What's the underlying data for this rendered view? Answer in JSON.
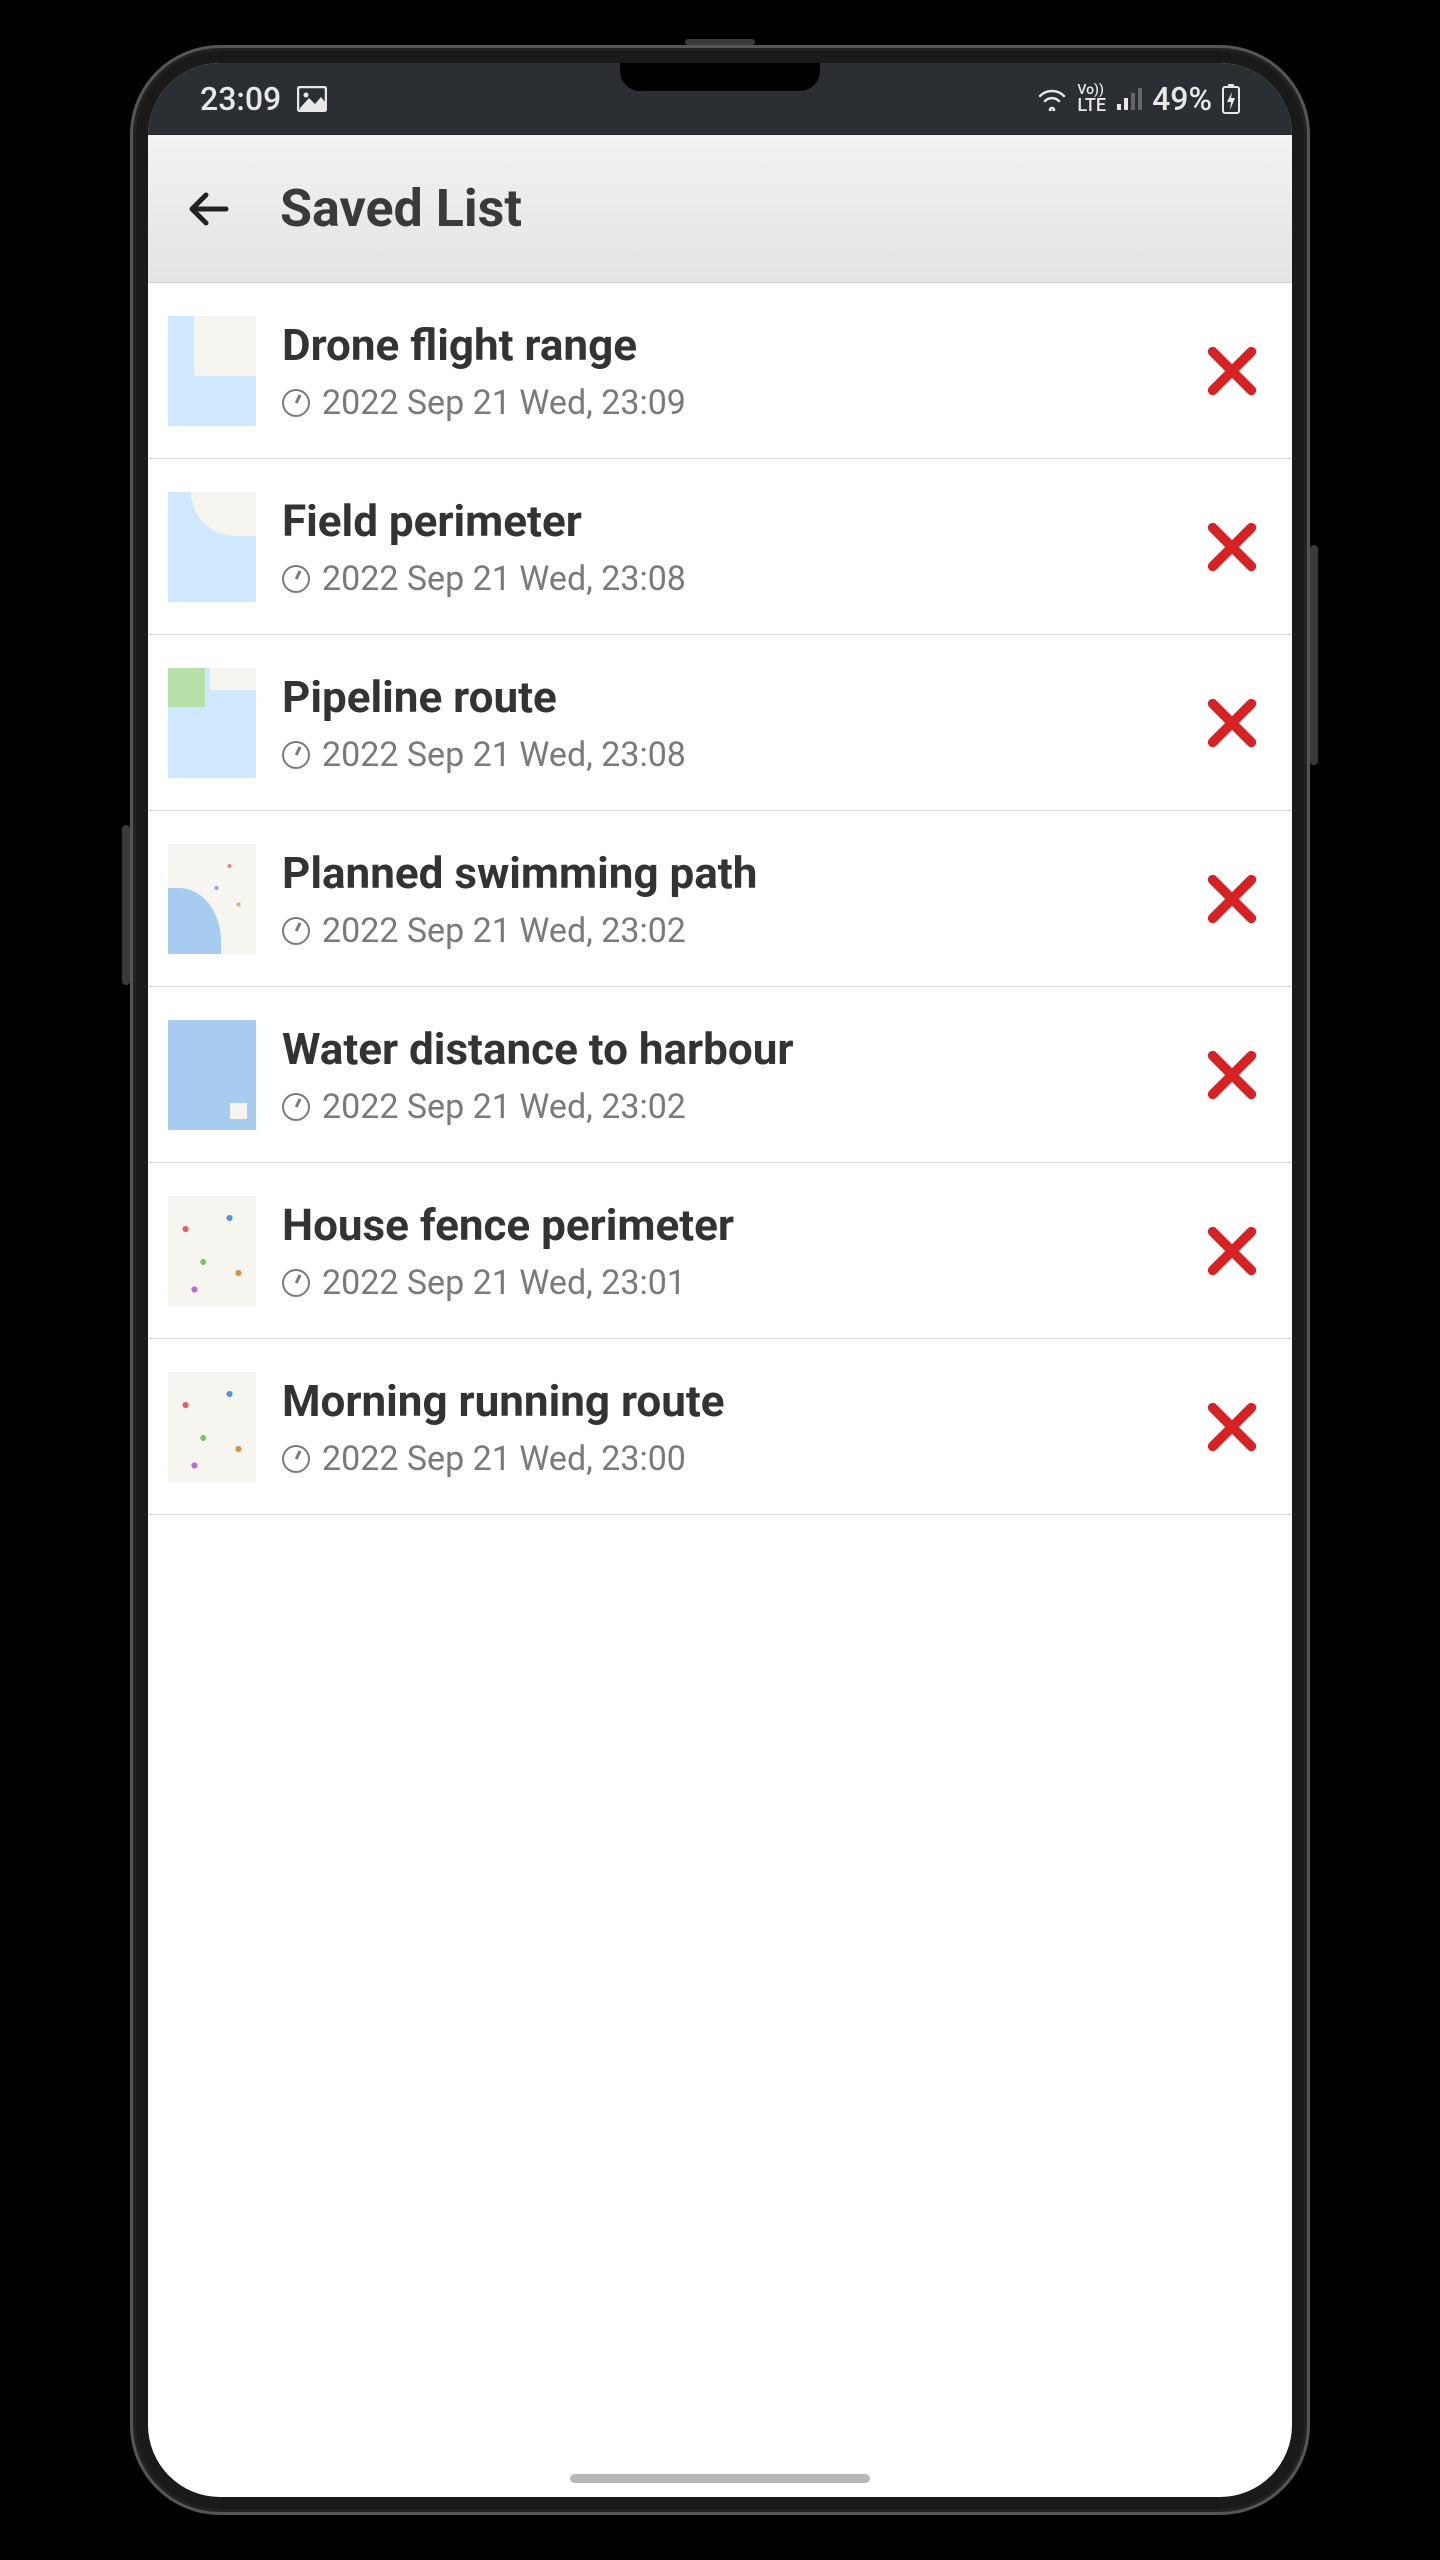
{
  "status": {
    "time": "23:09",
    "battery": "49%",
    "network_label": "LTE"
  },
  "header": {
    "title": "Saved List"
  },
  "items": [
    {
      "title": "Drone flight range",
      "timestamp": "2022 Sep 21 Wed, 23:09",
      "thumb": "land-a"
    },
    {
      "title": "Field perimeter",
      "timestamp": "2022 Sep 21 Wed, 23:08",
      "thumb": "land-b"
    },
    {
      "title": "Pipeline route",
      "timestamp": "2022 Sep 21 Wed, 23:08",
      "thumb": "land-c"
    },
    {
      "title": "Planned swimming path",
      "timestamp": "2022 Sep 21 Wed, 23:02",
      "thumb": "partial-water"
    },
    {
      "title": "Water distance to harbour",
      "timestamp": "2022 Sep 21 Wed, 23:02",
      "thumb": "water"
    },
    {
      "title": "House fence perimeter",
      "timestamp": "2022 Sep 21 Wed, 23:01",
      "thumb": "map"
    },
    {
      "title": "Morning running route",
      "timestamp": "2022 Sep 21 Wed, 23:00",
      "thumb": "map"
    }
  ]
}
